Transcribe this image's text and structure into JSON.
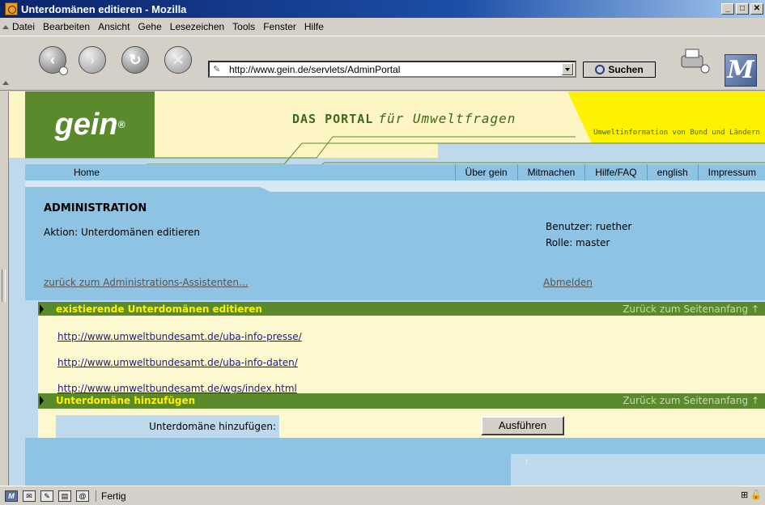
{
  "window": {
    "title": "Unterdomänen editieren - Mozilla"
  },
  "menu": {
    "items": [
      {
        "label": "Datei",
        "underline": "D"
      },
      {
        "label": "Bearbeiten",
        "underline": "B"
      },
      {
        "label": "Ansicht",
        "underline": "A"
      },
      {
        "label": "Gehe",
        "underline": "G"
      },
      {
        "label": "Lesezeichen",
        "underline": "L"
      },
      {
        "label": "Tools",
        "underline": "T"
      },
      {
        "label": "Fenster",
        "underline": "F"
      },
      {
        "label": "Hilfe",
        "underline": "H"
      }
    ]
  },
  "toolbar": {
    "url": "http://www.gein.de/servlets/AdminPortal",
    "search_label": "Suchen",
    "icons": [
      "back-icon",
      "forward-icon",
      "reload-icon",
      "stop-icon",
      "print-icon"
    ]
  },
  "header": {
    "logo_text": "gein",
    "logo_mark": "®",
    "portal_bold": "DAS PORTAL",
    "portal_italic": "für Umweltfragen",
    "tagline": "Umweltinformation von Bund und Ländern"
  },
  "nav": {
    "home": "Home",
    "links": [
      "Über gein",
      "Mitmachen",
      "Hilfe/FAQ",
      "english",
      "Impressum"
    ]
  },
  "admin": {
    "title": "ADMINISTRATION",
    "action": "Aktion: Unterdomänen editieren",
    "user": "Benutzer: ruether",
    "role": "Rolle: master",
    "back_link": "zurück zum Administrations-Assistenten...",
    "logout": "Abmelden"
  },
  "sections": {
    "existing_title": "existierende Unterdomänen editieren",
    "add_title": "Unterdomäne hinzufügen",
    "top_link": "Zurück zum Seitenanfang ↑"
  },
  "subdomains": [
    "http://www.umweltbundesamt.de/uba-info-presse/",
    "http://www.umweltbundesamt.de/uba-info-daten/",
    "http://www.umweltbundesamt.de/wgs/index.html"
  ],
  "add_form": {
    "label": "Unterdomäne hinzufügen:",
    "value": "",
    "button": "Ausführen"
  },
  "footer": {
    "up_mark": "↑"
  },
  "status": {
    "text": "Fertig"
  },
  "colors": {
    "green": "#5b8a2c",
    "yellow": "#fff200",
    "blue": "#8fc3e4",
    "light_blue": "#bfd9ec",
    "cream": "#fdf8d0"
  }
}
